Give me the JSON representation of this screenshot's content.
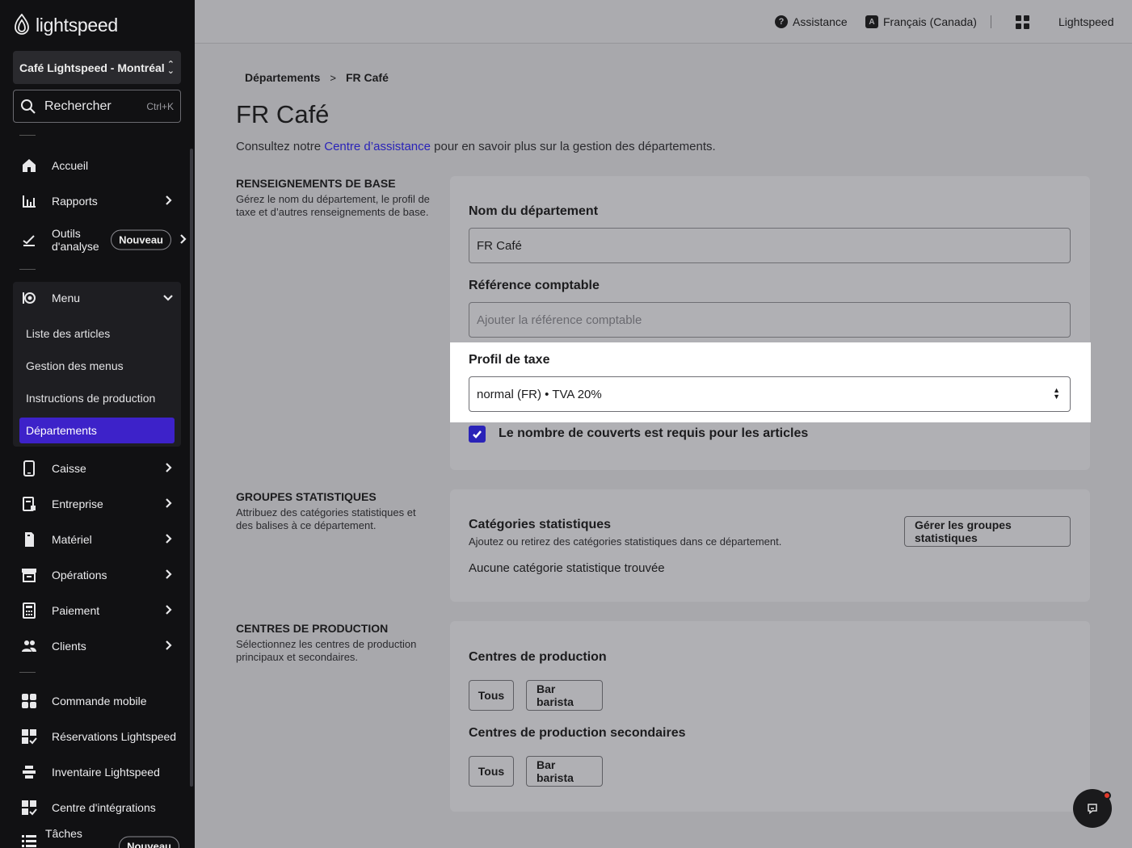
{
  "sidebar": {
    "brand": "lightspeed",
    "store": "Café Lightspeed - Montréal",
    "search": {
      "label": "Rechercher",
      "shortcut": "Ctrl+K"
    },
    "items": {
      "accueil": "Accueil",
      "rapports": "Rapports",
      "outils_line1": "Outils",
      "outils_line2": "d'analyse",
      "outils_badge": "Nouveau",
      "menu": "Menu",
      "caisse": "Caisse",
      "entreprise": "Entreprise",
      "materiel": "Matériel",
      "operations": "Opérations",
      "paiement": "Paiement",
      "clients": "Clients",
      "commande_mobile": "Commande mobile",
      "reservations": "Réservations Lightspeed",
      "inventaire": "Inventaire Lightspeed",
      "integrations": "Centre d'intégrations",
      "taches": "Tâches",
      "taches_badge": "Nouveau"
    },
    "menu_sub": {
      "articles": "Liste des articles",
      "gestion": "Gestion des menus",
      "instructions": "Instructions de production",
      "departements": "Départements"
    }
  },
  "header": {
    "assistance": "Assistance",
    "language": "Français (Canada)",
    "account": "Lightspeed"
  },
  "breadcrumb": {
    "parent": "Départements",
    "current": "FR Café"
  },
  "page": {
    "title": "FR Café",
    "intro_prefix": "Consultez notre ",
    "intro_link": "Centre d’assistance",
    "intro_suffix": " pour en savoir plus sur la gestion des départements."
  },
  "basic": {
    "title": "RENSEIGNEMENTS DE BASE",
    "desc": "Gérez le nom du département, le profil de taxe et d’autres renseignements de base.",
    "name_label": "Nom du département",
    "name_value": "FR Café",
    "ref_label": "Référence comptable",
    "ref_placeholder": "Ajouter la référence comptable",
    "tax_label": "Profil de taxe",
    "tax_value": "normal (FR) • TVA 20%",
    "covers_label": "Le nombre de couverts est requis pour les articles",
    "covers_checked": true
  },
  "stats": {
    "title": "GROUPES STATISTIQUES",
    "desc": "Attribuez des catégories statistiques et des balises à ce département.",
    "card_title": "Catégories statistiques",
    "card_desc": "Ajoutez ou retirez des catégories statistiques dans ce département.",
    "empty": "Aucune catégorie statistique trouvée",
    "manage_button": "Gérer les groupes statistiques"
  },
  "production": {
    "title": "CENTRES DE PRODUCTION",
    "desc": "Sélectionnez les centres de production principaux et secondaires.",
    "primary_label": "Centres de production",
    "secondary_label": "Centres de production secondaires",
    "primary_options": [
      "Tous",
      "Bar barista"
    ],
    "secondary_options": [
      "Tous",
      "Bar barista"
    ]
  },
  "colors": {
    "accent": "#3d22c9",
    "link": "#2a23b8",
    "sidebar_bg": "#111113",
    "notification": "#e23a2c"
  }
}
